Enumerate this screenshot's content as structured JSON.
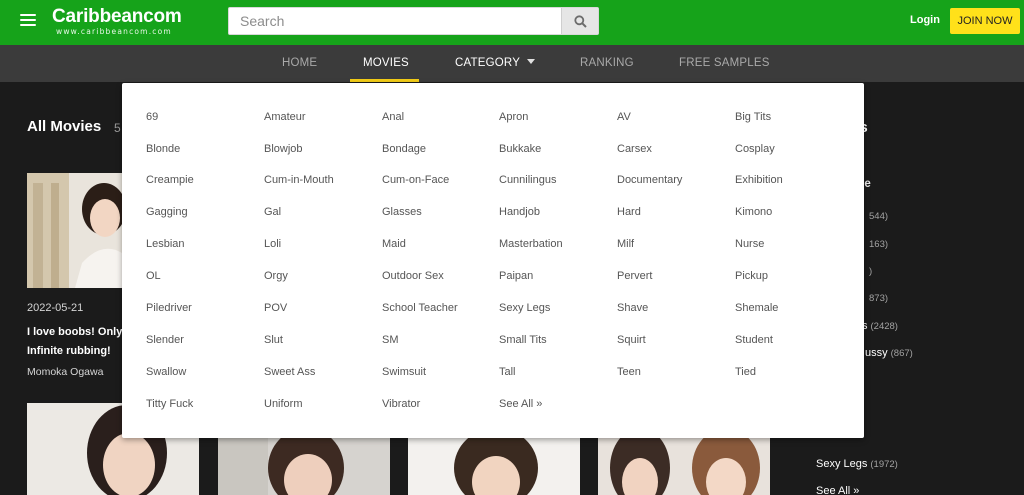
{
  "header": {
    "logo_text": "Caribbeancom",
    "logo_subtext": "www.caribbeancom.com",
    "search_placeholder": "Search",
    "login_label": "Login",
    "join_label": "JOIN NOW",
    "brand_color": "#16a31a",
    "join_color": "#ffe11a"
  },
  "nav": {
    "items": [
      "HOME",
      "MOVIES",
      "CATEGORY",
      "RANKING",
      "FREE SAMPLES"
    ],
    "active": "MOVIES"
  },
  "main": {
    "section_title": "All Movies",
    "section_count": "5",
    "movie": {
      "date": "2022-05-21",
      "title": "I love boobs! Only Infinite rubbing!",
      "actress": "Momoka Ogawa"
    }
  },
  "sidebar": {
    "title_fragment": "es",
    "subtitle_fragment": "ype",
    "rows": [
      {
        "label": "",
        "count": "544)"
      },
      {
        "label": "",
        "count": "163)"
      },
      {
        "label": "",
        "count": ")"
      },
      {
        "label": "",
        "count": "873)"
      },
      {
        "label": "s",
        "count": "(2428)"
      },
      {
        "label": "ussy",
        "count": "(867)"
      },
      {
        "label": "",
        "count": ""
      },
      {
        "label": "Sexy Legs",
        "count": "(1972)"
      },
      {
        "label": "See All »",
        "count": ""
      }
    ]
  },
  "dropdown": {
    "columns": [
      [
        "69",
        "Blonde",
        "Creampie",
        "Gagging",
        "Lesbian",
        "OL",
        "Piledriver",
        "Slender",
        "Swallow",
        "Titty Fuck"
      ],
      [
        "Amateur",
        "Blowjob",
        "Cum-in-Mouth",
        "Gal",
        "Loli",
        "Orgy",
        "POV",
        "Slut",
        "Sweet Ass",
        "Uniform"
      ],
      [
        "Anal",
        "Bondage",
        "Cum-on-Face",
        "Glasses",
        "Maid",
        "Outdoor Sex",
        "School Teacher",
        "SM",
        "Swimsuit",
        "Vibrator"
      ],
      [
        "Apron",
        "Bukkake",
        "Cunnilingus",
        "Handjob",
        "Masterbation",
        "Paipan",
        "Sexy Legs",
        "Small Tits",
        "Tall",
        "See All »"
      ],
      [
        "AV",
        "Carsex",
        "Documentary",
        "Hard",
        "Milf",
        "Pervert",
        "Shave",
        "Squirt",
        "Teen"
      ],
      [
        "Big Tits",
        "Cosplay",
        "Exhibition",
        "Kimono",
        "Nurse",
        "Pickup",
        "Shemale",
        "Student",
        "Tied"
      ]
    ]
  }
}
